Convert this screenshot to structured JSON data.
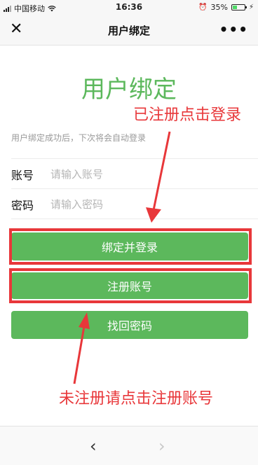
{
  "status_bar": {
    "carrier": "中国移动",
    "time": "16:36",
    "battery": "35%",
    "battery_level": 0.35
  },
  "nav": {
    "title": "用户绑定",
    "close_icon": "close-icon",
    "more_icon": "more-icon"
  },
  "page": {
    "heading": "用户绑定",
    "subtitle": "用户绑定成功后，下次将会自动登录"
  },
  "form": {
    "account_label": "账号",
    "account_placeholder": "请输入账号",
    "password_label": "密码",
    "password_placeholder": "请输入密码"
  },
  "buttons": {
    "bind_login": "绑定并登录",
    "register": "注册账号",
    "recover_password": "找回密码"
  },
  "annotations": {
    "registered_hint": "已注册点击登录",
    "unregistered_hint": "未注册请点击注册账号",
    "color": "#e8373a"
  },
  "toolbar": {
    "back_icon": "back-arrow-icon",
    "forward_icon": "forward-arrow-icon"
  },
  "colors": {
    "accent": "#5cb85c",
    "annotation": "#e8373a"
  }
}
